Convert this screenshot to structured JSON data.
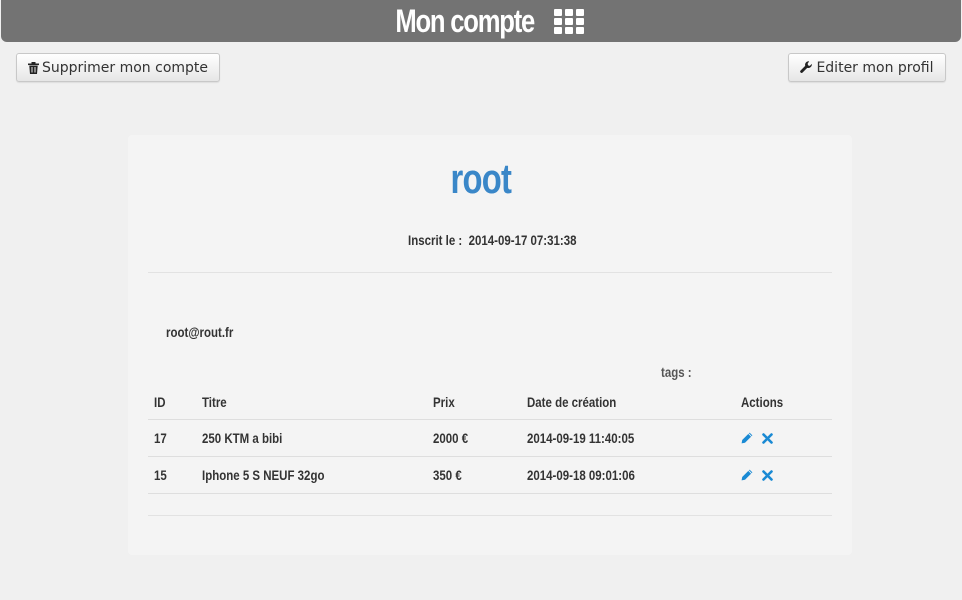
{
  "header": {
    "title": "Mon compte",
    "icon": "th-grid-icon"
  },
  "toolbar": {
    "delete_label": "Supprimer mon compte",
    "delete_icon": "trash-icon",
    "edit_label": "Editer mon profil",
    "edit_icon": "wrench-icon"
  },
  "profile": {
    "username": "root",
    "registered_label": "Inscrit le :",
    "registered_date": "2014-09-17 07:31:38",
    "email": "root@rout.fr",
    "tags_label": "tags :"
  },
  "table": {
    "columns": {
      "id": "ID",
      "titre": "Titre",
      "prix": "Prix",
      "date": "Date de création",
      "actions": "Actions"
    },
    "rows": [
      {
        "id": "17",
        "titre": "250 KTM a bibi",
        "prix": "2000 €",
        "date": "2014-09-19 11:40:05"
      },
      {
        "id": "15",
        "titre": "Iphone 5 S NEUF 32go",
        "prix": "350 €",
        "date": "2014-09-18 09:01:06"
      }
    ]
  },
  "colors": {
    "header_bg": "#737373",
    "accent": "#3a87c8",
    "action_icon": "#1a8ad4",
    "background": "#f0f0f0",
    "card": "#f4f4f4"
  }
}
